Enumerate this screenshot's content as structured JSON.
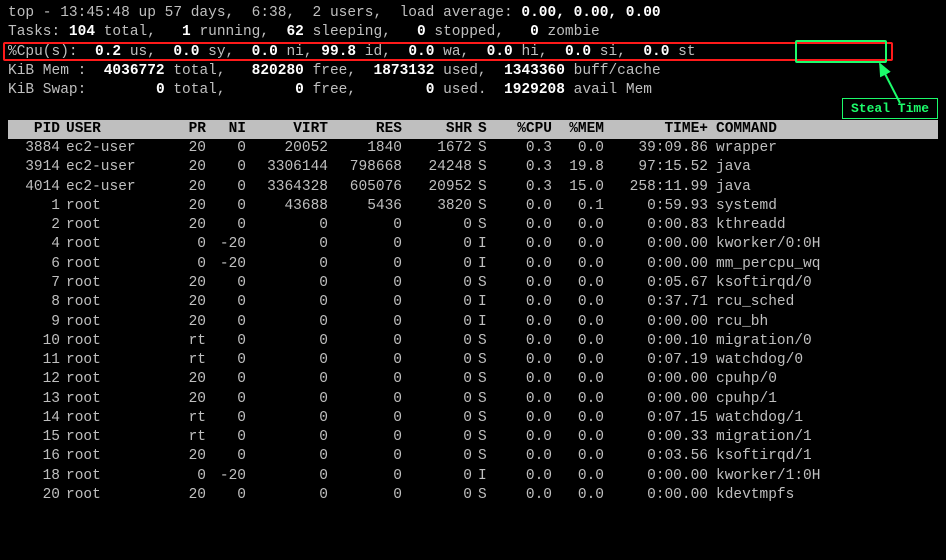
{
  "annotation": {
    "label": "Steal Time"
  },
  "sum": {
    "top": {
      "pre": "top - 13:45:48 up 57 days,  6:38,  2 users,  load average: ",
      "load": "0.00, 0.00, 0.00"
    },
    "tasks": {
      "l0": "Tasks: ",
      "total": "104",
      "l1": " total,   ",
      "run": "1",
      "l2": " running,  ",
      "sleep": "62",
      "l3": " sleeping,   ",
      "stop": "0",
      "l4": " stopped,   ",
      "zombie": "0",
      "l5": " zombie"
    },
    "cpu": {
      "l0": "%Cpu(s):  ",
      "us": "0.2",
      "l1": " us,  ",
      "sy": "0.0",
      "l2": " sy,  ",
      "ni": "0.0",
      "l3": " ni, ",
      "id": "99.8",
      "l4": " id,  ",
      "wa": "0.0",
      "l5": " wa,  ",
      "hi": "0.0",
      "l6": " hi,  ",
      "si": "0.0",
      "l7": " si,  ",
      "st": "0.0",
      "l8": " st"
    },
    "mem": {
      "l0": "KiB Mem :  ",
      "total": "4036772",
      "l1": " total,   ",
      "free": "820280",
      "l2": " free,  ",
      "used": "1873132",
      "l3": " used,  ",
      "buff": "1343360",
      "l4": " buff/cache"
    },
    "swap": {
      "l0": "KiB Swap:        ",
      "total": "0",
      "l1": " total,        ",
      "free": "0",
      "l2": " free,        ",
      "used": "0",
      "l3": " used.  ",
      "avail": "1929208",
      "l4": " avail Mem"
    }
  },
  "cols": {
    "pid": "PID",
    "user": "USER",
    "pr": "PR",
    "ni": "NI",
    "virt": "VIRT",
    "res": "RES",
    "shr": "SHR",
    "s": "S",
    "cpu": "%CPU",
    "mem": "%MEM",
    "time": "TIME+",
    "cmd": "COMMAND"
  },
  "procs": [
    {
      "pid": "3884",
      "user": "ec2-user",
      "pr": "20",
      "ni": "0",
      "virt": "20052",
      "res": "1840",
      "shr": "1672",
      "s": "S",
      "cpu": "0.3",
      "mem": "0.0",
      "time": "39:09.86",
      "cmd": "wrapper"
    },
    {
      "pid": "3914",
      "user": "ec2-user",
      "pr": "20",
      "ni": "0",
      "virt": "3306144",
      "res": "798668",
      "shr": "24248",
      "s": "S",
      "cpu": "0.3",
      "mem": "19.8",
      "time": "97:15.52",
      "cmd": "java"
    },
    {
      "pid": "4014",
      "user": "ec2-user",
      "pr": "20",
      "ni": "0",
      "virt": "3364328",
      "res": "605076",
      "shr": "20952",
      "s": "S",
      "cpu": "0.3",
      "mem": "15.0",
      "time": "258:11.99",
      "cmd": "java"
    },
    {
      "pid": "1",
      "user": "root",
      "pr": "20",
      "ni": "0",
      "virt": "43688",
      "res": "5436",
      "shr": "3820",
      "s": "S",
      "cpu": "0.0",
      "mem": "0.1",
      "time": "0:59.93",
      "cmd": "systemd"
    },
    {
      "pid": "2",
      "user": "root",
      "pr": "20",
      "ni": "0",
      "virt": "0",
      "res": "0",
      "shr": "0",
      "s": "S",
      "cpu": "0.0",
      "mem": "0.0",
      "time": "0:00.83",
      "cmd": "kthreadd"
    },
    {
      "pid": "4",
      "user": "root",
      "pr": "0",
      "ni": "-20",
      "virt": "0",
      "res": "0",
      "shr": "0",
      "s": "I",
      "cpu": "0.0",
      "mem": "0.0",
      "time": "0:00.00",
      "cmd": "kworker/0:0H"
    },
    {
      "pid": "6",
      "user": "root",
      "pr": "0",
      "ni": "-20",
      "virt": "0",
      "res": "0",
      "shr": "0",
      "s": "I",
      "cpu": "0.0",
      "mem": "0.0",
      "time": "0:00.00",
      "cmd": "mm_percpu_wq"
    },
    {
      "pid": "7",
      "user": "root",
      "pr": "20",
      "ni": "0",
      "virt": "0",
      "res": "0",
      "shr": "0",
      "s": "S",
      "cpu": "0.0",
      "mem": "0.0",
      "time": "0:05.67",
      "cmd": "ksoftirqd/0"
    },
    {
      "pid": "8",
      "user": "root",
      "pr": "20",
      "ni": "0",
      "virt": "0",
      "res": "0",
      "shr": "0",
      "s": "I",
      "cpu": "0.0",
      "mem": "0.0",
      "time": "0:37.71",
      "cmd": "rcu_sched"
    },
    {
      "pid": "9",
      "user": "root",
      "pr": "20",
      "ni": "0",
      "virt": "0",
      "res": "0",
      "shr": "0",
      "s": "I",
      "cpu": "0.0",
      "mem": "0.0",
      "time": "0:00.00",
      "cmd": "rcu_bh"
    },
    {
      "pid": "10",
      "user": "root",
      "pr": "rt",
      "ni": "0",
      "virt": "0",
      "res": "0",
      "shr": "0",
      "s": "S",
      "cpu": "0.0",
      "mem": "0.0",
      "time": "0:00.10",
      "cmd": "migration/0"
    },
    {
      "pid": "11",
      "user": "root",
      "pr": "rt",
      "ni": "0",
      "virt": "0",
      "res": "0",
      "shr": "0",
      "s": "S",
      "cpu": "0.0",
      "mem": "0.0",
      "time": "0:07.19",
      "cmd": "watchdog/0"
    },
    {
      "pid": "12",
      "user": "root",
      "pr": "20",
      "ni": "0",
      "virt": "0",
      "res": "0",
      "shr": "0",
      "s": "S",
      "cpu": "0.0",
      "mem": "0.0",
      "time": "0:00.00",
      "cmd": "cpuhp/0"
    },
    {
      "pid": "13",
      "user": "root",
      "pr": "20",
      "ni": "0",
      "virt": "0",
      "res": "0",
      "shr": "0",
      "s": "S",
      "cpu": "0.0",
      "mem": "0.0",
      "time": "0:00.00",
      "cmd": "cpuhp/1"
    },
    {
      "pid": "14",
      "user": "root",
      "pr": "rt",
      "ni": "0",
      "virt": "0",
      "res": "0",
      "shr": "0",
      "s": "S",
      "cpu": "0.0",
      "mem": "0.0",
      "time": "0:07.15",
      "cmd": "watchdog/1"
    },
    {
      "pid": "15",
      "user": "root",
      "pr": "rt",
      "ni": "0",
      "virt": "0",
      "res": "0",
      "shr": "0",
      "s": "S",
      "cpu": "0.0",
      "mem": "0.0",
      "time": "0:00.33",
      "cmd": "migration/1"
    },
    {
      "pid": "16",
      "user": "root",
      "pr": "20",
      "ni": "0",
      "virt": "0",
      "res": "0",
      "shr": "0",
      "s": "S",
      "cpu": "0.0",
      "mem": "0.0",
      "time": "0:03.56",
      "cmd": "ksoftirqd/1"
    },
    {
      "pid": "18",
      "user": "root",
      "pr": "0",
      "ni": "-20",
      "virt": "0",
      "res": "0",
      "shr": "0",
      "s": "I",
      "cpu": "0.0",
      "mem": "0.0",
      "time": "0:00.00",
      "cmd": "kworker/1:0H"
    },
    {
      "pid": "20",
      "user": "root",
      "pr": "20",
      "ni": "0",
      "virt": "0",
      "res": "0",
      "shr": "0",
      "s": "S",
      "cpu": "0.0",
      "mem": "0.0",
      "time": "0:00.00",
      "cmd": "kdevtmpfs"
    }
  ]
}
